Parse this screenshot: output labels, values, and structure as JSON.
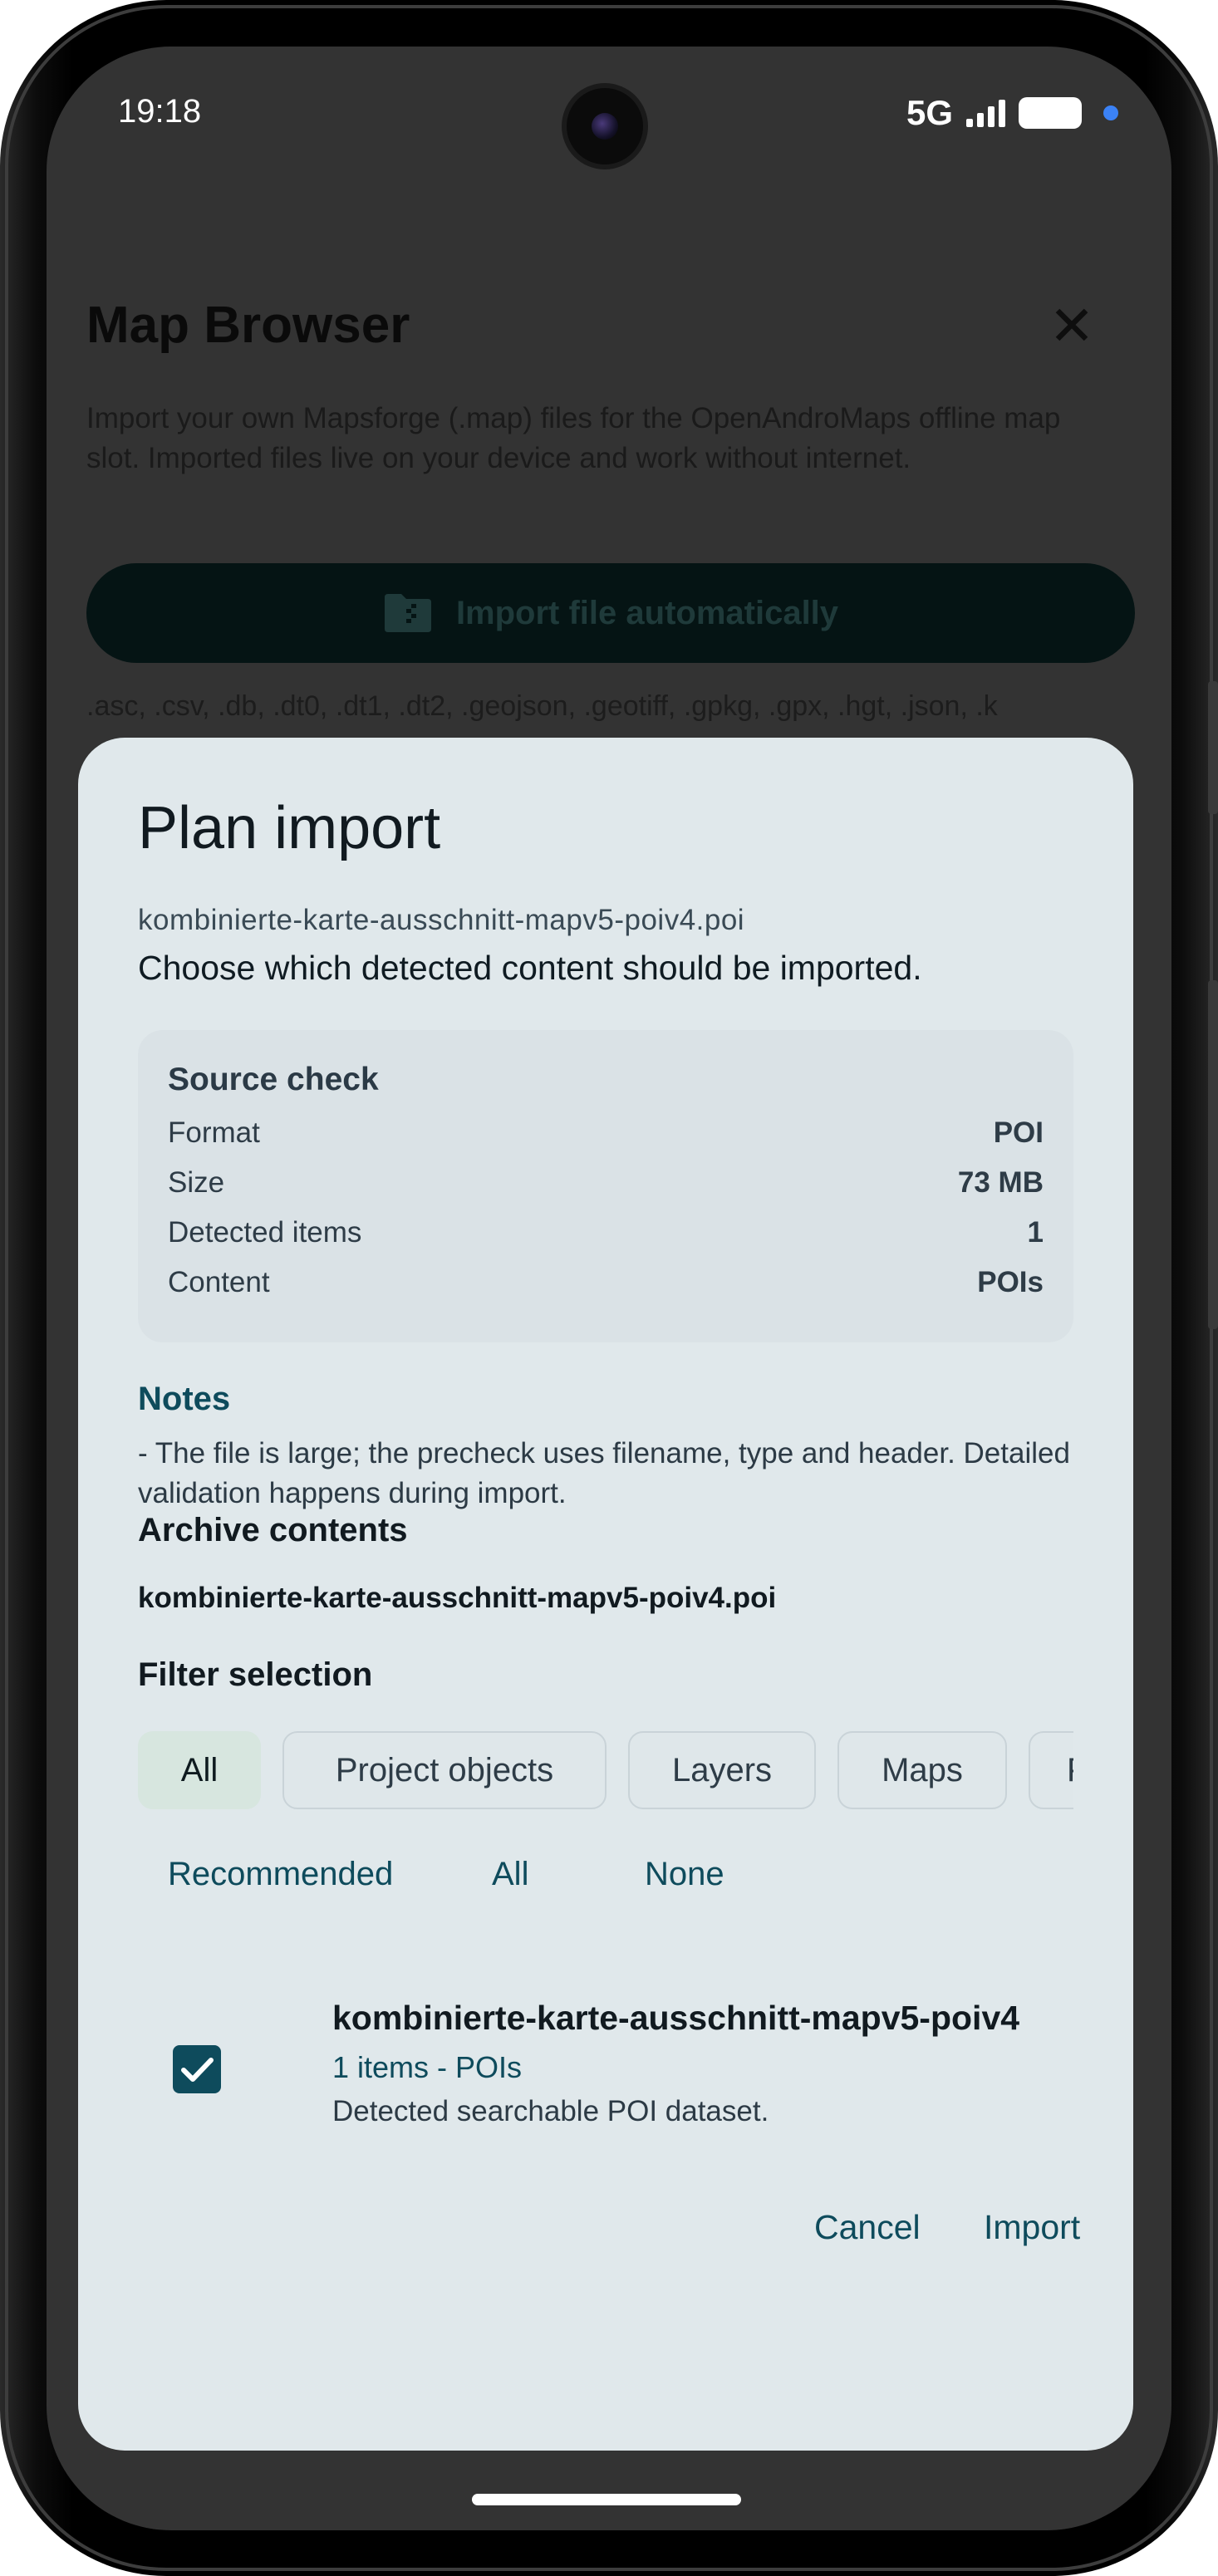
{
  "status": {
    "time": "19:18",
    "network": "5G"
  },
  "background": {
    "title": "Map Browser",
    "description": "Import your own Mapsforge (.map) files for the OpenAndroMaps offline map slot. Imported files live on your device and work without internet.",
    "import_button": "Import file automatically",
    "extensions": ".asc, .csv, .db, .dt0, .dt1, .dt2, .geojson, .geotiff, .gpkg, .gpx, .hgt, .json, .k"
  },
  "dialog": {
    "title": "Plan import",
    "file_name": "kombinierte-karte-ausschnitt-mapv5-poiv4.poi",
    "subtitle": "Choose which detected content should be imported.",
    "source_check": {
      "title": "Source check",
      "rows": [
        {
          "label": "Format",
          "value": "POI"
        },
        {
          "label": "Size",
          "value": "73 MB"
        },
        {
          "label": "Detected items",
          "value": "1"
        },
        {
          "label": "Content",
          "value": "POIs"
        }
      ]
    },
    "notes": {
      "title": "Notes",
      "text": "- The file is large; the precheck uses filename, type and header. Detailed validation happens during import."
    },
    "archive": {
      "title": "Archive contents",
      "file": "kombinierte-karte-ausschnitt-mapv5-poiv4.poi"
    },
    "filter": {
      "title": "Filter selection",
      "chips": [
        "All",
        "Project objects",
        "Layers",
        "Maps",
        "P"
      ]
    },
    "selection_buttons": [
      "Recommended",
      "All",
      "None"
    ],
    "item": {
      "title": "kombinierte-karte-ausschnitt-mapv5-poiv4",
      "meta": "1 items - POIs",
      "description": "Detected searchable POI dataset.",
      "checked": true
    },
    "actions": {
      "cancel": "Cancel",
      "import": "Import"
    }
  },
  "colors": {
    "accent": "#0e4b5c",
    "dialog_bg": "#e0e8eb",
    "scrim": "#333333"
  }
}
